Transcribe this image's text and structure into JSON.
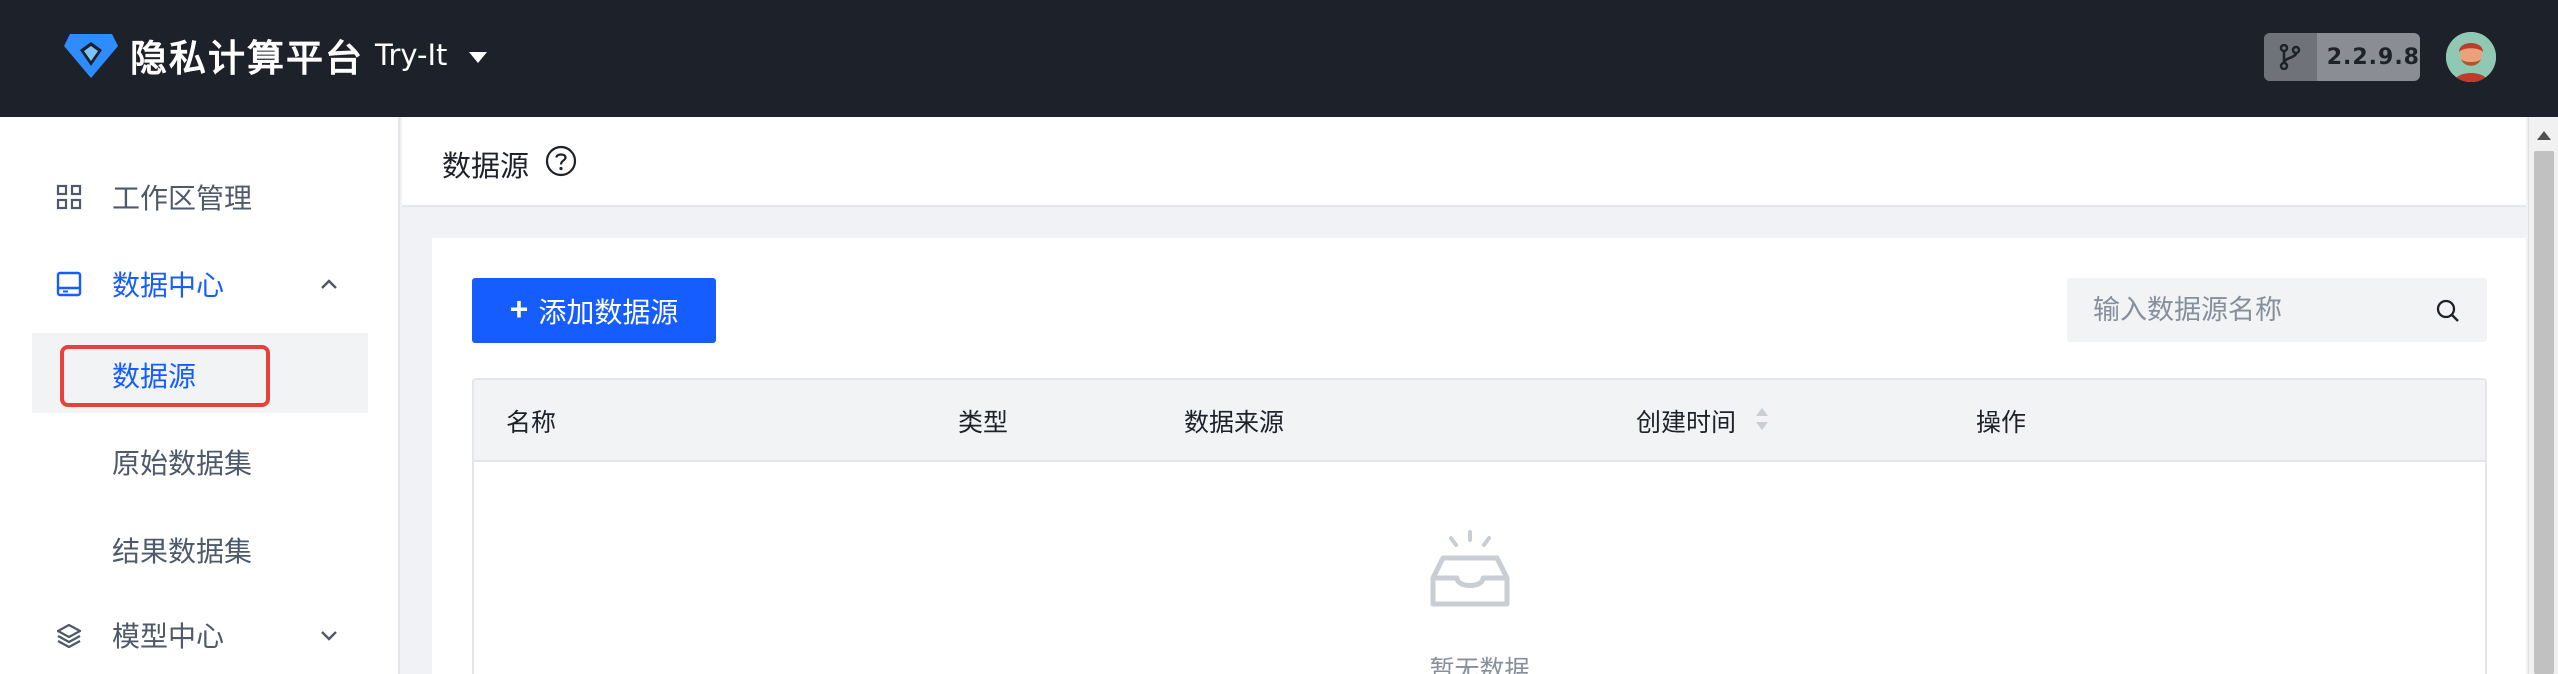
{
  "topbar": {
    "brand": "隐私计算平台",
    "workspace": "Try-It",
    "version": "2.2.9.8"
  },
  "sidebar": {
    "items": [
      {
        "label": "工作区管理",
        "icon": "grid-icon"
      },
      {
        "label": "数据中心",
        "icon": "database-icon",
        "expanded": true,
        "children": [
          {
            "label": "数据源",
            "selected": true
          },
          {
            "label": "原始数据集"
          },
          {
            "label": "结果数据集"
          }
        ]
      },
      {
        "label": "模型中心",
        "icon": "layers-icon",
        "expanded": false
      }
    ]
  },
  "page": {
    "title": "数据源"
  },
  "toolbar": {
    "add_label": "添加数据源",
    "search_placeholder": "输入数据源名称"
  },
  "table": {
    "columns": [
      "名称",
      "类型",
      "数据来源",
      "创建时间",
      "操作"
    ],
    "rows": [],
    "empty_text": "暂无数据"
  },
  "colors": {
    "accent": "#165dff",
    "topbar_bg": "#1d2129",
    "highlight": "#e8413c"
  }
}
